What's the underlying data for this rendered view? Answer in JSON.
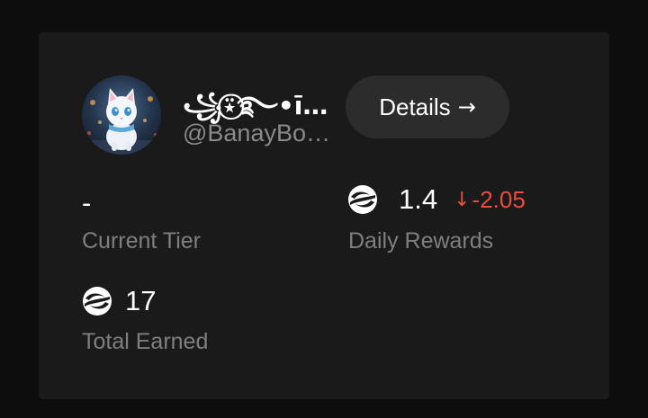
{
  "profile": {
    "display_name": "꧁⍣⃝࿐•īm…",
    "handle": "@BanayBo…"
  },
  "actions": {
    "details_label": "Details",
    "details_icon": "arrow-right-icon",
    "details_arrow": "→"
  },
  "stats": {
    "current_tier": {
      "value": "-",
      "label": "Current Tier"
    },
    "daily_rewards": {
      "icon": "token-coin-icon",
      "value": "1.4",
      "delta_icon": "arrow-down-icon",
      "delta_arrow": "↓",
      "delta": "-2.05",
      "label": "Daily Rewards"
    },
    "total_earned": {
      "icon": "token-coin-icon",
      "value": "17",
      "label": "Total Earned"
    }
  },
  "colors": {
    "page_background": "#0d0d0d",
    "card_background": "#1a1a1a",
    "button_background": "#2c2c2c",
    "label_gray": "#7f7f7f",
    "negative_delta": "#ee4a3e",
    "text_white": "#ffffff"
  }
}
